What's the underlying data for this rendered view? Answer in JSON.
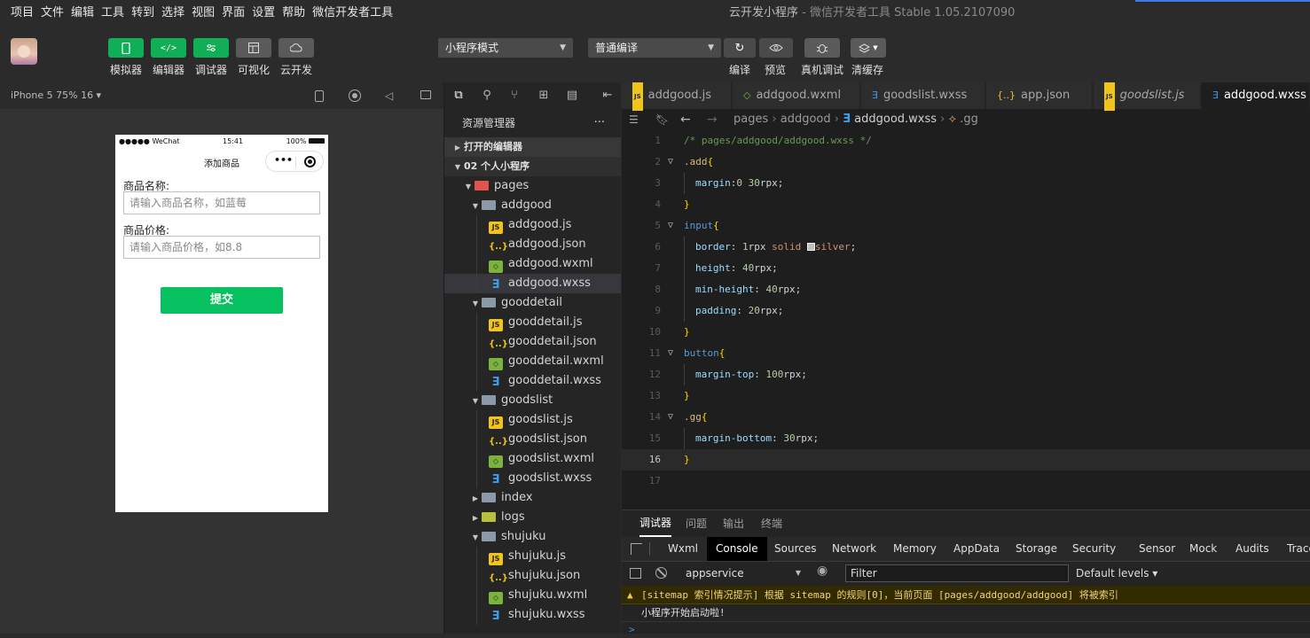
{
  "menubar": {
    "items": [
      "项目",
      "文件",
      "编辑",
      "工具",
      "转到",
      "选择",
      "视图",
      "界面",
      "设置",
      "帮助",
      "微信开发者工具"
    ],
    "window_title": "云开发小程序",
    "window_subtitle": " - 微信开发者工具 Stable 1.05.2107090"
  },
  "toolbar": {
    "simulator": "模拟器",
    "editor": "编辑器",
    "debugger": "调试器",
    "visualize": "可视化",
    "cloud": "云开发",
    "mode_select": "小程序模式",
    "compile_select": "普通编译",
    "compile": "编译",
    "preview": "预览",
    "remote_debug": "真机调试",
    "clear_cache": "清缓存"
  },
  "simulator": {
    "device": "iPhone 5 75% 16 ▾",
    "carrier": "●●●●● WeChat",
    "time": "15:41",
    "battery": "100%",
    "page_title": "添加商品",
    "capsule_dots": "•••",
    "name_label": "商品名称:",
    "name_placeholder": "请输入商品名称，如蓝莓",
    "price_label": "商品价格:",
    "price_placeholder": "请输入商品价格，如8.8",
    "submit": "提交"
  },
  "explorer": {
    "title": "资源管理器",
    "more": "···",
    "open_editors": "打开的编辑器",
    "project": "02 个人小程序",
    "tree": [
      {
        "label": "pages",
        "type": "folder-red",
        "depth": 0,
        "open": true
      },
      {
        "label": "addgood",
        "type": "folder",
        "depth": 1,
        "open": true
      },
      {
        "label": "addgood.js",
        "type": "js",
        "depth": 2
      },
      {
        "label": "addgood.json",
        "type": "json",
        "depth": 2
      },
      {
        "label": "addgood.wxml",
        "type": "wxml",
        "depth": 2
      },
      {
        "label": "addgood.wxss",
        "type": "wxss",
        "depth": 2,
        "selected": true
      },
      {
        "label": "gooddetail",
        "type": "folder",
        "depth": 1,
        "open": true
      },
      {
        "label": "gooddetail.js",
        "type": "js",
        "depth": 2
      },
      {
        "label": "gooddetail.json",
        "type": "json",
        "depth": 2
      },
      {
        "label": "gooddetail.wxml",
        "type": "wxml",
        "depth": 2
      },
      {
        "label": "gooddetail.wxss",
        "type": "wxss",
        "depth": 2
      },
      {
        "label": "goodslist",
        "type": "folder",
        "depth": 1,
        "open": true
      },
      {
        "label": "goodslist.js",
        "type": "js",
        "depth": 2
      },
      {
        "label": "goodslist.json",
        "type": "json",
        "depth": 2
      },
      {
        "label": "goodslist.wxml",
        "type": "wxml",
        "depth": 2
      },
      {
        "label": "goodslist.wxss",
        "type": "wxss",
        "depth": 2
      },
      {
        "label": "index",
        "type": "folder",
        "depth": 1,
        "open": false
      },
      {
        "label": "logs",
        "type": "folder-logs",
        "depth": 1,
        "open": false
      },
      {
        "label": "shujuku",
        "type": "folder",
        "depth": 1,
        "open": true
      },
      {
        "label": "shujuku.js",
        "type": "js",
        "depth": 2
      },
      {
        "label": "shujuku.json",
        "type": "json",
        "depth": 2
      },
      {
        "label": "shujuku.wxml",
        "type": "wxml",
        "depth": 2
      },
      {
        "label": "shujuku.wxss",
        "type": "wxss",
        "depth": 2
      }
    ]
  },
  "editor": {
    "tabs": [
      {
        "label": "addgood.js",
        "type": "js"
      },
      {
        "label": "addgood.wxml",
        "type": "wxml"
      },
      {
        "label": "goodslist.wxss",
        "type": "wxss"
      },
      {
        "label": "app.json",
        "type": "json"
      },
      {
        "label": "goodslist.js",
        "type": "js",
        "italic": true
      },
      {
        "label": "addgood.wxss",
        "type": "wxss",
        "active": true
      }
    ],
    "breadcrumb": [
      "pages",
      "addgood",
      "addgood.wxss",
      ".gg"
    ],
    "lines": [
      {
        "n": "1",
        "html": "<span class='c-com'>/* pages/addgood/addgood.wxss */</span>"
      },
      {
        "n": "2",
        "fold": true,
        "html": "<span class='c-sel'>.add</span><span class='c-br'>{</span>"
      },
      {
        "n": "3",
        "html": "  <span class='c-prop'>margin</span>:<span class='c-num'>0</span> <span class='c-num'>30</span>rpx;"
      },
      {
        "n": "4",
        "html": "<span class='c-br'>}</span>"
      },
      {
        "n": "5",
        "fold": true,
        "html": "<span class='c-tag'>input</span><span class='c-br'>{</span>"
      },
      {
        "n": "6",
        "html": "  <span class='c-prop'>border</span>: <span class='c-num'>1</span>rpx <span class='c-kw'>solid</span> <span style='display:inline-block;width:9px;height:9px;background:#c0c0c0;border:1px solid #eee;vertical-align:-1px'></span><span class='c-kw'>silver</span>;"
      },
      {
        "n": "7",
        "html": "  <span class='c-prop'>height</span>: <span class='c-num'>40</span>rpx;"
      },
      {
        "n": "8",
        "html": "  <span class='c-prop'>min-height</span>: <span class='c-num'>40</span>rpx;"
      },
      {
        "n": "9",
        "html": "  <span class='c-prop'>padding</span>: <span class='c-num'>20</span>rpx;"
      },
      {
        "n": "10",
        "html": "<span class='c-br'>}</span>"
      },
      {
        "n": "11",
        "fold": true,
        "html": "<span class='c-tag'>button</span><span class='c-br'>{</span>"
      },
      {
        "n": "12",
        "html": "  <span class='c-prop'>margin-top</span>: <span class='c-num'>100</span>rpx;"
      },
      {
        "n": "13",
        "html": "<span class='c-br'>}</span>"
      },
      {
        "n": "14",
        "fold": true,
        "html": "<span class='c-sel'>.gg</span><span class='c-br'>{</span>"
      },
      {
        "n": "15",
        "html": "  <span class='c-prop'>margin-bottom</span>: <span class='c-num'>30</span>rpx;"
      },
      {
        "n": "16",
        "cur": true,
        "html": "<span class='c-br'>}</span>"
      },
      {
        "n": "17",
        "html": ""
      }
    ]
  },
  "debug": {
    "tabs": [
      "调试器",
      "问题",
      "输出",
      "终端"
    ],
    "devtools_tabs": [
      "Wxml",
      "Console",
      "Sources",
      "Network",
      "Memory",
      "AppData",
      "Storage",
      "Security",
      "Sensor",
      "Mock",
      "Audits",
      "Trace"
    ],
    "context": "appservice",
    "filter_placeholder": "Filter",
    "levels": "Default levels ▾",
    "warning": "[sitemap 索引情况提示] 根据 sitemap 的规则[0]，当前页面 [pages/addgood/addgood] 将被索引",
    "log": "小程序开始启动啦!",
    "prompt": ">"
  }
}
